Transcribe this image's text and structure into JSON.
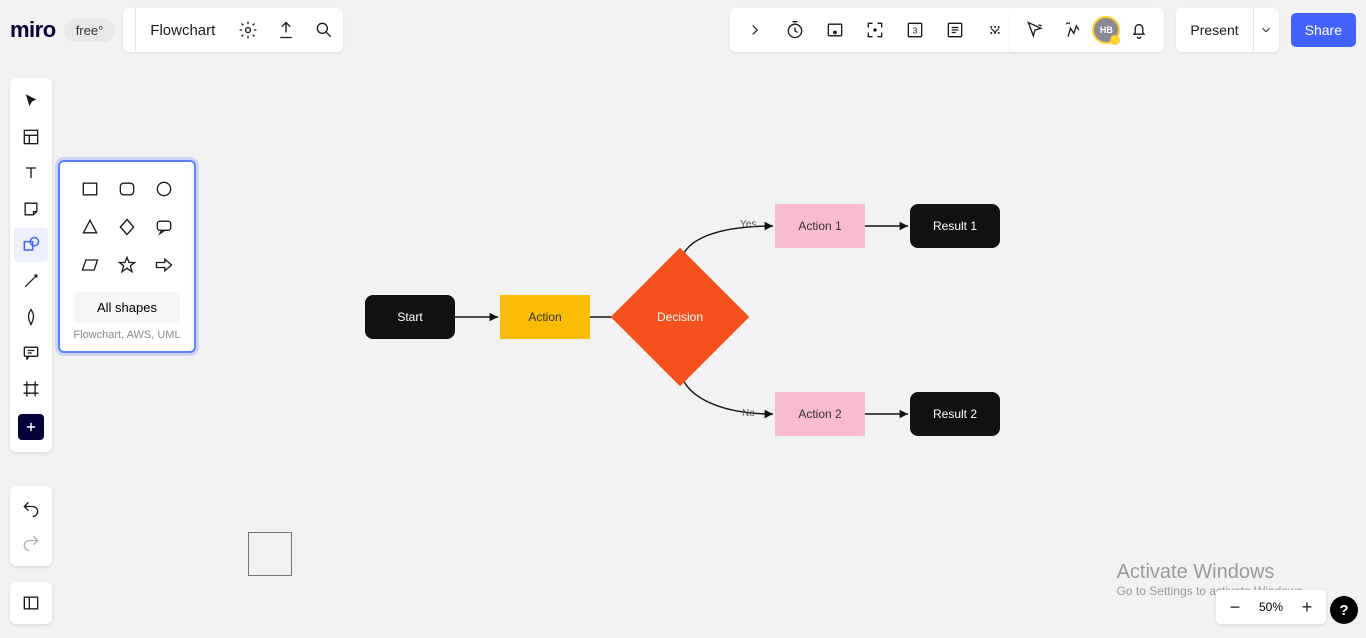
{
  "app": {
    "logo": "miro",
    "plan": "free°",
    "board_name": "Flowchart"
  },
  "header_icons": [
    "settings",
    "export",
    "search"
  ],
  "top_center_icons": [
    "expand",
    "timer",
    "hide-frames",
    "fit",
    "slides",
    "comments",
    "more"
  ],
  "top_right": {
    "avatar_initials": "HB",
    "present_label": "Present",
    "share_label": "Share"
  },
  "toolbar": {
    "items": [
      "select",
      "templates",
      "text",
      "sticky",
      "shapes",
      "line",
      "pen",
      "comment",
      "frame"
    ],
    "active": "shapes"
  },
  "shapes_popout": {
    "shapes": [
      "rectangle",
      "rounded-rect",
      "circle",
      "triangle",
      "diamond",
      "speech",
      "parallelogram",
      "star",
      "arrow-right"
    ],
    "all_shapes_label": "All shapes",
    "subtitle": "Flowchart, AWS, UML"
  },
  "canvas": {
    "nodes": {
      "start": {
        "label": "Start"
      },
      "action": {
        "label": "Action"
      },
      "decision": {
        "label": "Decision"
      },
      "action1": {
        "label": "Action 1"
      },
      "action2": {
        "label": "Action 2"
      },
      "result1": {
        "label": "Result 1"
      },
      "result2": {
        "label": "Result 2"
      }
    },
    "edge_labels": {
      "yes": "Yes",
      "no": "No"
    }
  },
  "zoom": {
    "percent": "50%"
  },
  "watermark": {
    "line1": "Activate Windows",
    "line2": "Go to Settings to activate Windows."
  },
  "help": "?"
}
